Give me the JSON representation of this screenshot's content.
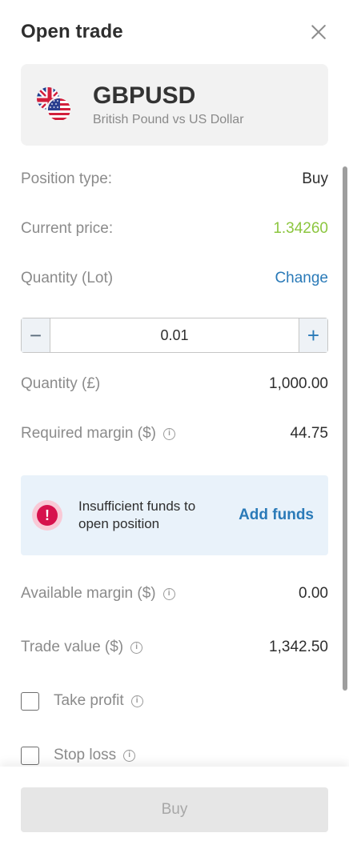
{
  "header": {
    "title": "Open trade"
  },
  "instrument": {
    "symbol": "GBPUSD",
    "description": "British Pound vs US Dollar",
    "flags": [
      "uk-flag-icon",
      "us-flag-icon"
    ]
  },
  "position_type": {
    "label": "Position type:",
    "value": "Buy"
  },
  "current_price": {
    "label": "Current price:",
    "value": "1.34260",
    "color": "#8cc63f"
  },
  "quantity_lot": {
    "label": "Quantity (Lot)",
    "action": "Change"
  },
  "stepper": {
    "value": "0.01",
    "minus": "−",
    "plus": "+"
  },
  "quantity_gbp": {
    "label": "Quantity (£)",
    "value": "1,000.00"
  },
  "required_margin": {
    "label": "Required margin ($)",
    "value": "44.75"
  },
  "alert": {
    "message": "Insufficient funds to open position",
    "action": "Add funds",
    "icon": "exclamation-icon",
    "color": "#d6124d"
  },
  "available_margin": {
    "label": "Available margin ($)",
    "value": "0.00"
  },
  "trade_value": {
    "label": "Trade value ($)",
    "value": "1,342.50"
  },
  "take_profit": {
    "label": "Take profit",
    "checked": false
  },
  "stop_loss": {
    "label": "Stop loss",
    "checked": false
  },
  "footer": {
    "buy_label": "Buy"
  },
  "info_glyph": "i",
  "accent_color": "#2a7ab8"
}
